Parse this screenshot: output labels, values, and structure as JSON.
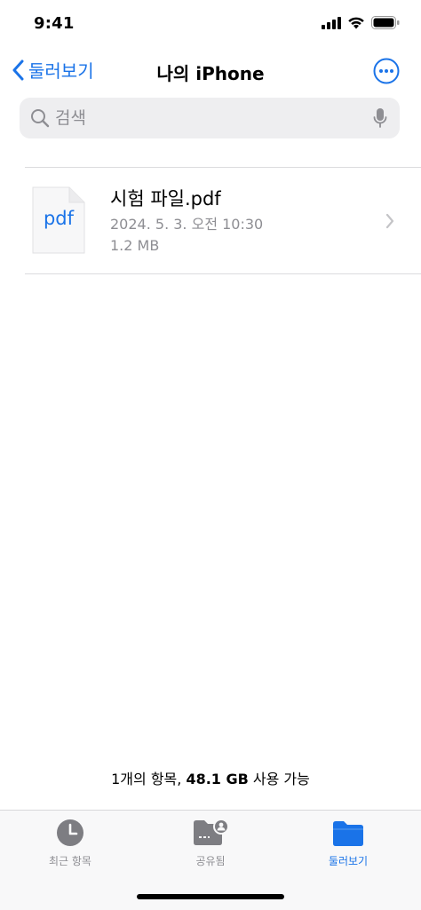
{
  "status_bar": {
    "time": "9:41"
  },
  "nav": {
    "back_label": "둘러보기",
    "title": "나의 iPhone"
  },
  "search": {
    "placeholder": "검색"
  },
  "files": [
    {
      "name": "시험 파일.pdf",
      "icon_label": "pdf",
      "date": "2024. 5. 3. 오전 10:30",
      "size": "1.2 MB"
    }
  ],
  "footer": {
    "count_text": "1개의 항목,",
    "free_space": "48.1 GB",
    "free_text": "사용 가능"
  },
  "tabs": [
    {
      "label": "최근 항목",
      "icon": "clock-icon",
      "active": false
    },
    {
      "label": "공유됨",
      "icon": "shared-folder-icon",
      "active": false
    },
    {
      "label": "둘러보기",
      "icon": "folder-icon",
      "active": true
    }
  ],
  "colors": {
    "accent": "#1a73e8",
    "secondary_text": "#8e8e93",
    "search_bg": "#eeeef0",
    "tab_inactive_icon": "#7d7d82"
  }
}
